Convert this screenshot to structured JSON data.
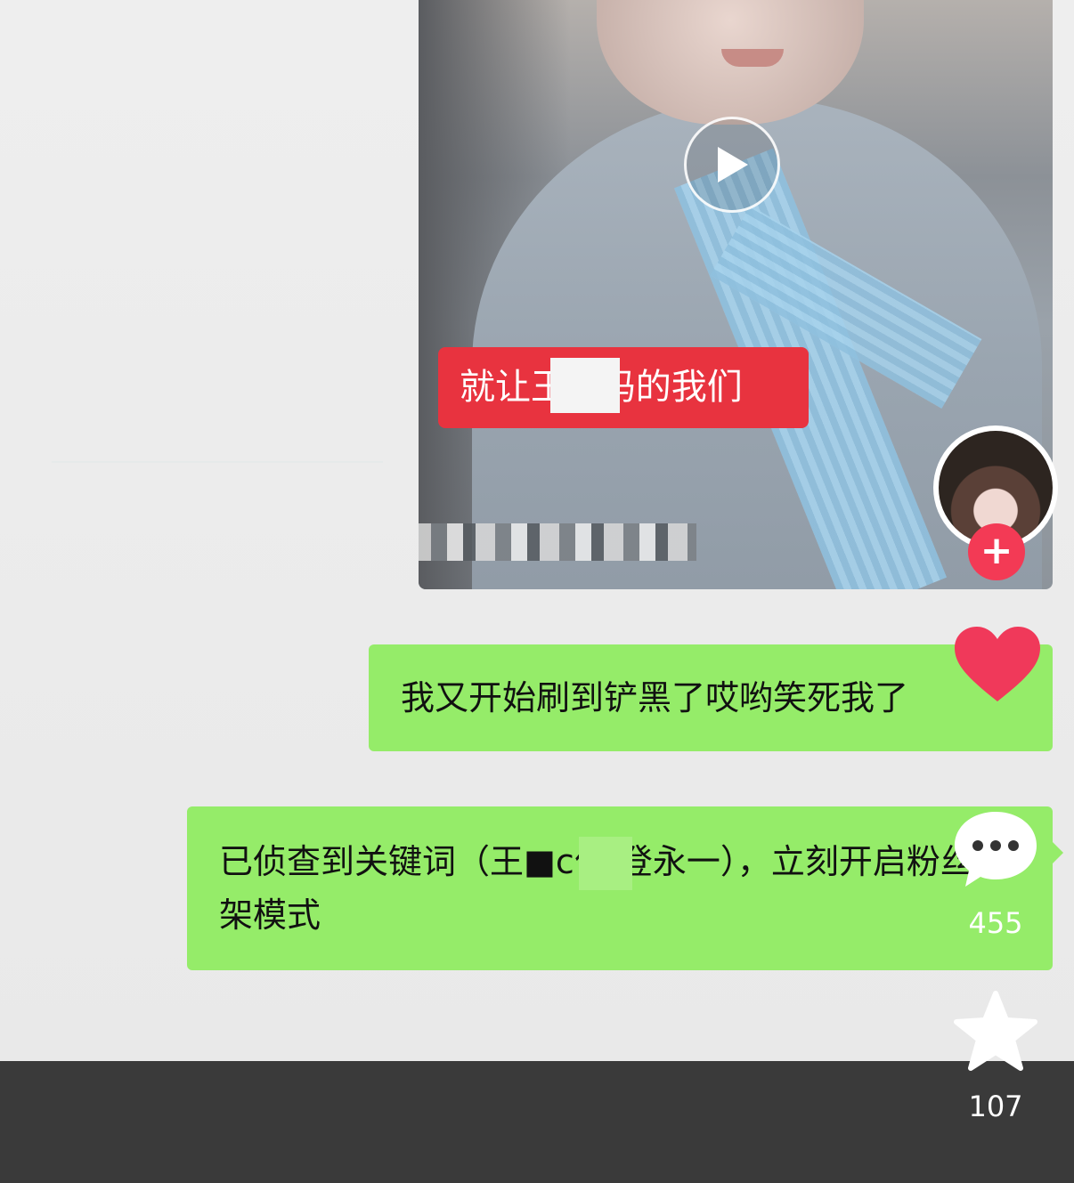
{
  "video": {
    "caption": "就让王■妈的我们",
    "author_name": ""
  },
  "actions": {
    "follow_label": "+",
    "like_count": "",
    "comment_count": "455",
    "favorite_count": "107"
  },
  "messages": [
    {
      "text": "我又开始刷到铲黑了哎哟笑死我了"
    },
    {
      "text": "已侦查到关键词（王■c位 登永一），立刻开启粉丝吵架模式"
    }
  ],
  "colors": {
    "bubble_green": "#95ec69",
    "caption_red": "#e8333f",
    "like_red": "#f0395a",
    "follow_red": "#f33a55",
    "bottom_bar": "#3a3a3a"
  },
  "icons": [
    "play-icon",
    "heart-icon",
    "comment-icon",
    "star-icon",
    "plus-icon"
  ]
}
